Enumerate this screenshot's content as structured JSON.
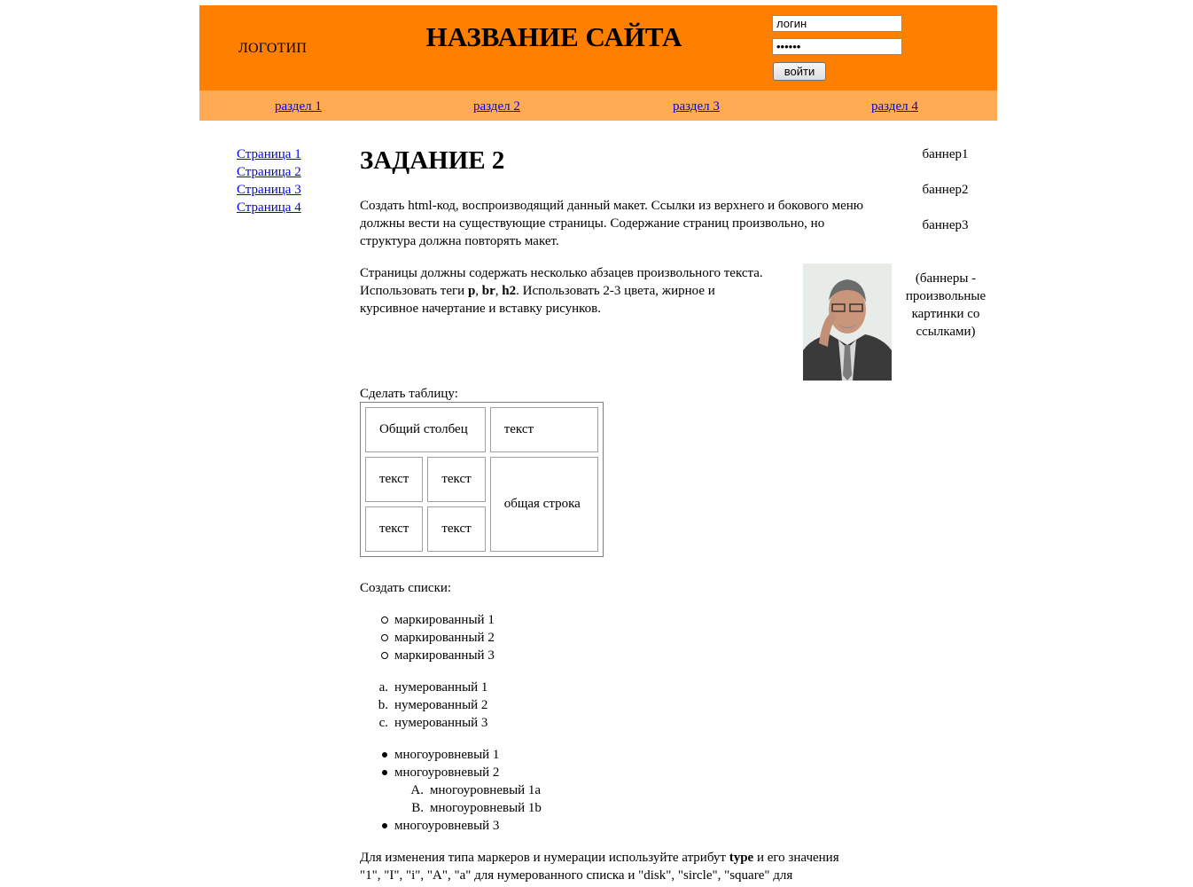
{
  "header": {
    "logo": "ЛОГОТИП",
    "site_title": "НАЗВАНИЕ САЙТА",
    "login_value": "логин",
    "password_value": "••••••",
    "login_button": "войти",
    "bg_color": "#ff8000"
  },
  "nav": {
    "bg_color": "#ffaa55",
    "items": [
      "раздел 1",
      "раздел 2",
      "раздел 3",
      "раздел 4"
    ]
  },
  "sidebar": {
    "items": [
      "Страница 1",
      "Страница 2",
      "Страница 3",
      "Страница 4"
    ]
  },
  "banners": {
    "items": [
      "баннер1",
      "баннер2",
      "баннер3"
    ],
    "note": "(баннеры - произвольные картинки со ссылками)"
  },
  "main": {
    "title": "ЗАДАНИЕ 2",
    "para1": "Создать html-код, воспроизводящий данный макет. Ссылки из верхнего и бокового меню должны вести на существующие страницы. Содержание страниц произвольно, но структура должна повторять макет.",
    "para2_lines": [
      "Страницы должны содержать несколько абзацев произвольного текста.",
      "Использовать теги p, br, h2. Использовать 2-3 цвета, жирное и",
      "курсивное начертание и вставку рисунков."
    ],
    "table_intro": "Сделать таблицу:",
    "table": {
      "r1c1": "Общий столбец",
      "r1c2": "текст",
      "r2c1": "текст",
      "r2c2": "текст",
      "r2c3": "общая строка",
      "r3c1": "текст",
      "r3c2": "текст"
    },
    "lists_intro": "Создать списки:",
    "bullet_list": [
      "маркированный 1",
      "маркированный 2",
      "маркированный 3"
    ],
    "numbered_list": {
      "markers": [
        "a.",
        "b.",
        "c."
      ],
      "items": [
        "нумерованный 1",
        "нумерованный 2",
        "нумерованный 3"
      ]
    },
    "multilevel_list": {
      "item1": "многоуровневый 1",
      "item2": "многоуровневый 2",
      "sub_markers": [
        "A.",
        "B."
      ],
      "sub_items": [
        "многоуровневый 1a",
        "многоуровневый 1b"
      ],
      "item3": "многоуровневый 3"
    },
    "footer_line1_pre": "Для изменения типа маркеров и нумерации используйте атрибут",
    "footer_line1_bold": "type",
    "footer_line1_post": "и его значения",
    "footer_line2": "\"1\", \"I\", \"i\", \"A\", \"a\" для нумерованного списка и \"disk\", \"sircle\", \"square\" для"
  }
}
